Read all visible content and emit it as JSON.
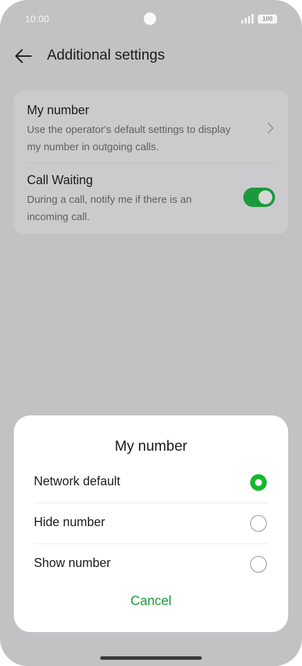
{
  "status_bar": {
    "time": "10:00",
    "battery": "100",
    "icons": [
      "camera-dot",
      "signal-icon",
      "battery-icon"
    ]
  },
  "header": {
    "back_icon": "arrow-left-icon",
    "title": "Additional settings"
  },
  "settings": {
    "my_number": {
      "title": "My number",
      "subtitle": "Use the operator's default settings to display my number in outgoing calls.",
      "icon": "chevron-right-icon"
    },
    "call_waiting": {
      "title": "Call Waiting",
      "subtitle": "During a call, notify me if there is an incoming call.",
      "enabled": true
    }
  },
  "dialog": {
    "title": "My number",
    "options": [
      {
        "label": "Network default",
        "selected": true
      },
      {
        "label": "Hide number",
        "selected": false
      },
      {
        "label": "Show number",
        "selected": false
      }
    ],
    "cancel_label": "Cancel"
  },
  "colors": {
    "accent": "#1b9a3b",
    "radio_selected": "#14b82e",
    "scrim": "#c2c2c4"
  }
}
